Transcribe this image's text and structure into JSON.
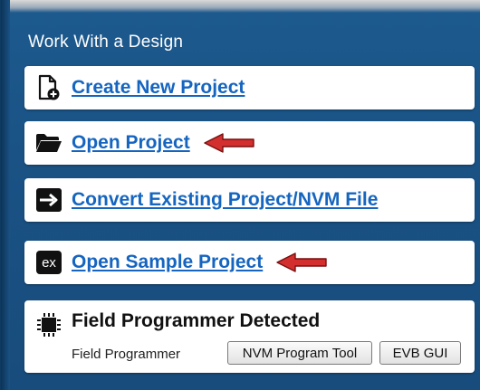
{
  "panel": {
    "title": "Work With a Design"
  },
  "actions": [
    {
      "label": "Create New Project",
      "icon": "new-document-icon"
    },
    {
      "label": "Open Project",
      "icon": "folder-open-icon",
      "annotation": "red-arrow"
    },
    {
      "label": "Convert Existing Project/NVM File",
      "icon": "convert-arrow-icon"
    },
    {
      "label": "Open Sample Project",
      "icon": "ex-badge-icon",
      "badge_text": "ex",
      "annotation": "red-arrow"
    }
  ],
  "detection": {
    "title": "Field Programmer Detected",
    "device_label": "Field Programmer",
    "buttons": {
      "nvm_tool": "NVM Program Tool",
      "evb_gui": "EVB GUI"
    }
  },
  "colors": {
    "panel_bg": "#1a5285",
    "link": "#1565c0",
    "arrow": "#d32f2f"
  }
}
